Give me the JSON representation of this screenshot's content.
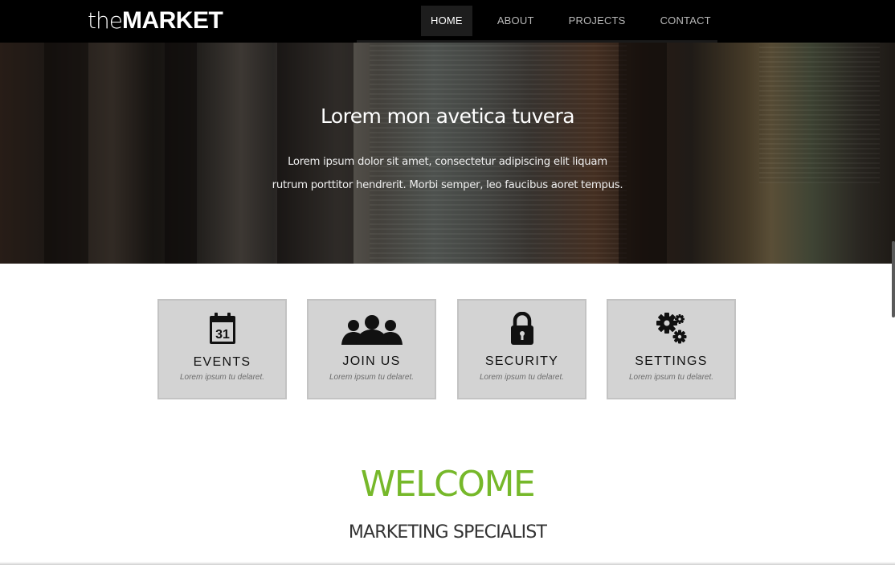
{
  "brand": {
    "prefix": "the",
    "name": "MARKET"
  },
  "nav": {
    "items": [
      {
        "label": "HOME",
        "active": true
      },
      {
        "label": "ABOUT",
        "active": false
      },
      {
        "label": "PROJECTS",
        "active": false
      },
      {
        "label": "CONTACT",
        "active": false
      }
    ]
  },
  "hero": {
    "title": "Lorem mon avetica tuvera",
    "text": "Lorem ipsum dolor sit amet, consectetur adipiscing elit liquam rutrum porttitor hendrerit. Morbi semper, leo faucibus aoret tempus."
  },
  "features": [
    {
      "title": "EVENTS",
      "subtitle": "Lorem ipsum tu delaret.",
      "icon": "calendar-icon",
      "icon_text": "31"
    },
    {
      "title": "JOIN US",
      "subtitle": "Lorem ipsum tu delaret.",
      "icon": "users-icon"
    },
    {
      "title": "SECURITY",
      "subtitle": "Lorem ipsum tu delaret.",
      "icon": "lock-icon"
    },
    {
      "title": "SETTINGS",
      "subtitle": "Lorem ipsum tu delaret.",
      "icon": "gears-icon"
    }
  ],
  "welcome": {
    "title": "WELCOME",
    "subtitle": "MARKETING SPECIALIST"
  },
  "colors": {
    "accent": "#76b82a",
    "navbar": "#000000",
    "card_bg": "#d3d3d3"
  }
}
